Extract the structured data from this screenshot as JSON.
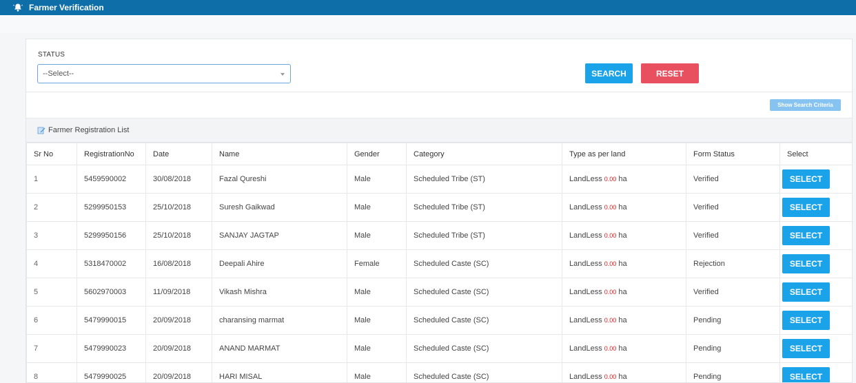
{
  "header": {
    "title": "Farmer Verification"
  },
  "filter": {
    "status_label": "STATUS",
    "status_selected": "--Select--",
    "search_label": "SEARCH",
    "reset_label": "RESET"
  },
  "criteria_label": "Show Search Criteria",
  "list_title": "Farmer Registration List",
  "columns": [
    "Sr No",
    "RegistrationNo",
    "Date",
    "Name",
    "Gender",
    "Category",
    "Type as per land",
    "Form Status",
    "Select"
  ],
  "rows": [
    {
      "sr": "1",
      "reg": "5459590002",
      "date": "30/08/2018",
      "name": "Fazal Qureshi",
      "gender": "Male",
      "category": "Scheduled Tribe (ST)",
      "land_type": "LandLess",
      "area": "0.00",
      "unit": "ha",
      "status": "Verified"
    },
    {
      "sr": "2",
      "reg": "5299950153",
      "date": "25/10/2018",
      "name": "Suresh Gaikwad",
      "gender": "Male",
      "category": "Scheduled Tribe (ST)",
      "land_type": "LandLess",
      "area": "0.00",
      "unit": "ha",
      "status": "Verified"
    },
    {
      "sr": "3",
      "reg": "5299950156",
      "date": "25/10/2018",
      "name": "SANJAY JAGTAP",
      "gender": "Male",
      "category": "Scheduled Tribe (ST)",
      "land_type": "LandLess",
      "area": "0.00",
      "unit": "ha",
      "status": "Verified"
    },
    {
      "sr": "4",
      "reg": "5318470002",
      "date": "16/08/2018",
      "name": "Deepali Ahire",
      "gender": "Female",
      "category": "Scheduled Caste (SC)",
      "land_type": "LandLess",
      "area": "0.00",
      "unit": "ha",
      "status": "Rejection"
    },
    {
      "sr": "5",
      "reg": "5602970003",
      "date": "11/09/2018",
      "name": "Vikash Mishra",
      "gender": "Male",
      "category": "Scheduled Caste (SC)",
      "land_type": "LandLess",
      "area": "0.00",
      "unit": "ha",
      "status": "Verified"
    },
    {
      "sr": "6",
      "reg": "5479990015",
      "date": "20/09/2018",
      "name": "charansing marmat",
      "gender": "Male",
      "category": "Scheduled Caste (SC)",
      "land_type": "LandLess",
      "area": "0.00",
      "unit": "ha",
      "status": "Pending"
    },
    {
      "sr": "7",
      "reg": "5479990023",
      "date": "20/09/2018",
      "name": "ANAND MARMAT",
      "gender": "Male",
      "category": "Scheduled Caste (SC)",
      "land_type": "LandLess",
      "area": "0.00",
      "unit": "ha",
      "status": "Pending"
    },
    {
      "sr": "8",
      "reg": "5479990025",
      "date": "20/09/2018",
      "name": "HARI MISAL",
      "gender": "Male",
      "category": "Scheduled Caste (SC)",
      "land_type": "LandLess",
      "area": "0.00",
      "unit": "ha",
      "status": "Pending"
    }
  ],
  "select_label": "SELECT",
  "icons": {
    "header": "bell-icon",
    "list": "edit-icon"
  },
  "colors": {
    "topbar": "#0e6fa8",
    "primary": "#1aa3e8",
    "danger": "#e9505f",
    "area": "#d9191b"
  }
}
